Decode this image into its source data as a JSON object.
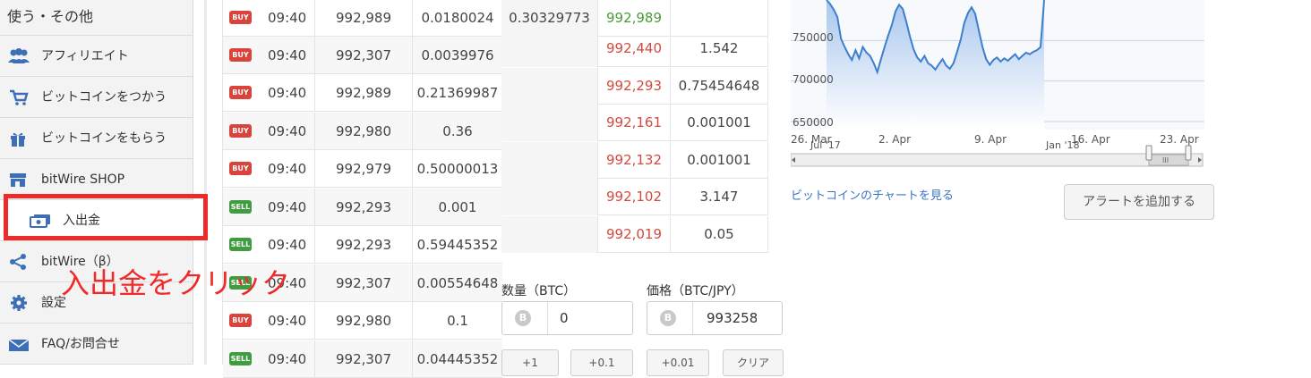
{
  "sidebar": {
    "header": "使う・その他",
    "items": [
      {
        "label": "アフィリエイト",
        "icon": "users-icon"
      },
      {
        "label": "ビットコインをつかう",
        "icon": "cart-icon"
      },
      {
        "label": "ビットコインをもらう",
        "icon": "gift-icon"
      },
      {
        "label": "bitWire SHOP",
        "icon": "shop-icon"
      },
      {
        "label": "入出金",
        "icon": "money-icon"
      },
      {
        "label": "bitWire（β）",
        "icon": "share-icon"
      },
      {
        "label": "設定",
        "icon": "gear-icon"
      },
      {
        "label": "FAQ/お問合せ",
        "icon": "mail-icon"
      }
    ]
  },
  "annotation": "入出金をクリック",
  "trades": [
    {
      "side": "BUY",
      "time": "09:40",
      "price": "992,989",
      "amount": "0.0180024"
    },
    {
      "side": "BUY",
      "time": "09:40",
      "price": "992,307",
      "amount": "0.0039976"
    },
    {
      "side": "BUY",
      "time": "09:40",
      "price": "992,989",
      "amount": "0.21369987"
    },
    {
      "side": "BUY",
      "time": "09:40",
      "price": "992,980",
      "amount": "0.36"
    },
    {
      "side": "BUY",
      "time": "09:40",
      "price": "992,979",
      "amount": "0.50000013"
    },
    {
      "side": "SELL",
      "time": "09:40",
      "price": "992,293",
      "amount": "0.001"
    },
    {
      "side": "SELL",
      "time": "09:40",
      "price": "992,293",
      "amount": "0.59445352"
    },
    {
      "side": "SELL",
      "time": "09:40",
      "price": "992,307",
      "amount": "0.00554648"
    },
    {
      "side": "BUY",
      "time": "09:40",
      "price": "992,980",
      "amount": "0.1"
    },
    {
      "side": "SELL",
      "time": "09:40",
      "price": "992,307",
      "amount": "0.04445352"
    }
  ],
  "order_book": [
    {
      "total": "0.30329773",
      "price": "992,989",
      "amount": "",
      "price_color": "#4a9b3a"
    },
    {
      "total": "",
      "price": "992,440",
      "amount": "1.542",
      "price_color": "#d34a3f"
    },
    {
      "total": "",
      "price": "992,293",
      "amount": "0.75454648",
      "price_color": "#d34a3f"
    },
    {
      "total": "",
      "price": "992,161",
      "amount": "0.001001",
      "price_color": "#d34a3f"
    },
    {
      "total": "",
      "price": "992,132",
      "amount": "0.001001",
      "price_color": "#d34a3f"
    },
    {
      "total": "",
      "price": "992,102",
      "amount": "3.147",
      "price_color": "#d34a3f"
    },
    {
      "total": "",
      "price": "992,019",
      "amount": "0.05",
      "price_color": "#d34a3f"
    }
  ],
  "order_form": {
    "qty_label": "数量（BTC）",
    "qty_value": "0",
    "price_label": "価格（BTC/JPY）",
    "price_value": "993258",
    "btc_symbol": "B",
    "quick_buttons": [
      "+1",
      "+0.1",
      "+0.01",
      "クリア"
    ]
  },
  "chart_data": {
    "type": "line",
    "y_ticks": [
      "750000",
      "700000",
      "650000"
    ],
    "x_ticks": [
      "26. Mar",
      "2. Apr",
      "9. Apr",
      "16. Apr",
      "23. Apr"
    ],
    "navigator_labels": [
      "Jul '17",
      "Jan '18"
    ],
    "ylim": [
      640000,
      800000
    ],
    "series": [
      {
        "x": [
          0,
          0.2,
          0.4,
          0.6,
          0.8,
          1.0,
          1.2,
          1.4,
          1.6,
          1.8,
          2.0,
          2.2,
          2.4,
          2.6,
          2.8,
          3.0,
          3.2,
          3.4,
          3.6,
          3.8,
          4.0,
          4.2,
          4.4,
          4.6,
          4.8,
          5.0,
          5.2,
          5.4,
          5.6,
          5.8,
          6.0,
          6.2,
          6.4,
          6.6,
          6.8,
          7.0,
          7.2,
          7.4,
          7.6,
          7.8,
          8.0,
          8.2,
          8.4,
          8.6,
          8.8,
          9.0,
          9.2,
          9.4,
          9.6,
          9.8,
          10.0,
          10.2,
          10.4,
          10.6,
          10.8,
          11.0,
          11.2,
          11.4,
          11.6,
          11.8,
          12.0
        ],
        "values": [
          800000,
          795000,
          788000,
          779000,
          752000,
          742000,
          733000,
          726000,
          738000,
          728000,
          742000,
          735000,
          731000,
          722000,
          711000,
          727000,
          742000,
          756000,
          769000,
          786000,
          794000,
          789000,
          773000,
          755000,
          739000,
          729000,
          724000,
          731000,
          722000,
          719000,
          714000,
          721000,
          727000,
          719000,
          715000,
          722000,
          736000,
          751000,
          772000,
          784000,
          791000,
          783000,
          762000,
          742000,
          727000,
          720000,
          726000,
          729000,
          724000,
          728000,
          725000,
          729000,
          733000,
          727000,
          731000,
          735000,
          733000,
          736000,
          738000,
          742000,
          800000
        ]
      }
    ]
  },
  "chart_link": "ビットコインのチャートを見る",
  "alert_button": "アラートを追加する",
  "colors": {
    "accent_red": "#ef2a2a",
    "buy": "#d9433b",
    "sell": "#3f9d3f",
    "link": "#3a74c6",
    "line": "#3d7fcc"
  }
}
